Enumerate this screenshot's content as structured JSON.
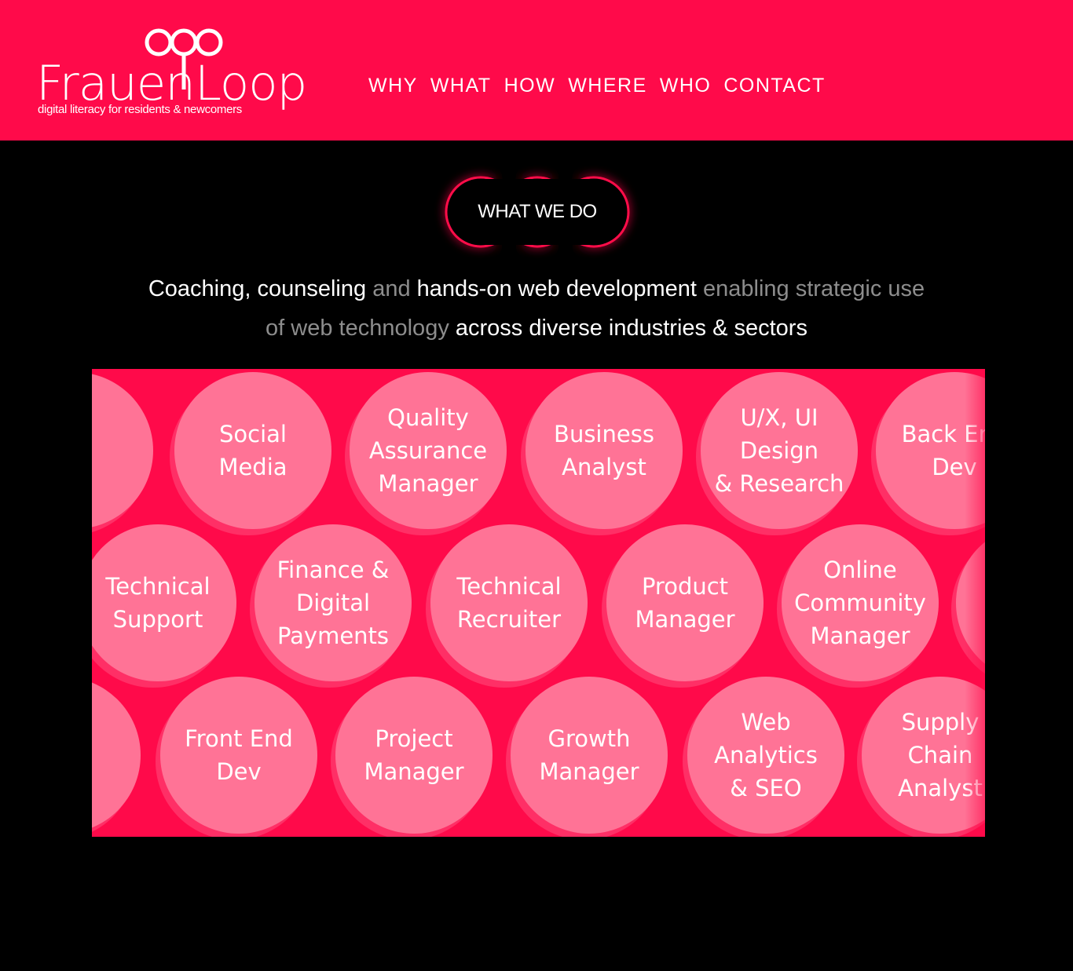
{
  "brand": {
    "name": "FrauenLoop",
    "tagline": "digital literacy for residents & newcomers",
    "colors": {
      "primary": "#ff0a4a",
      "bubble": "#ff7396",
      "background": "#000000",
      "dim_text": "#8d8d8d"
    }
  },
  "nav": {
    "items": [
      "WHY",
      "WHAT",
      "HOW",
      "WHERE",
      "WHO",
      "CONTACT"
    ]
  },
  "section": {
    "badge": "WHAT WE DO",
    "tagline": {
      "part1": "Coaching, counseling",
      "part2": "and",
      "part3": "hands-on web development",
      "part4": "enabling strategic use of web technology",
      "part5": "across diverse industries & sectors"
    }
  },
  "roles": {
    "row1": [
      "",
      "Social\nMedia",
      "Quality\nAssurance\nManager",
      "Business\nAnalyst",
      "U/X, UI\nDesign\n& Research",
      "Back End\nDev"
    ],
    "row2": [
      "Technical\nSupport",
      "Finance &\nDigital\nPayments",
      "Technical\nRecruiter",
      "Product\nManager",
      "Online\nCommunity\nManager",
      ""
    ],
    "row3": [
      "",
      "Front End\nDev",
      "Project\nManager",
      "Growth\nManager",
      "Web\nAnalytics\n& SEO",
      "Supply\nChain\nAnalyst"
    ]
  }
}
